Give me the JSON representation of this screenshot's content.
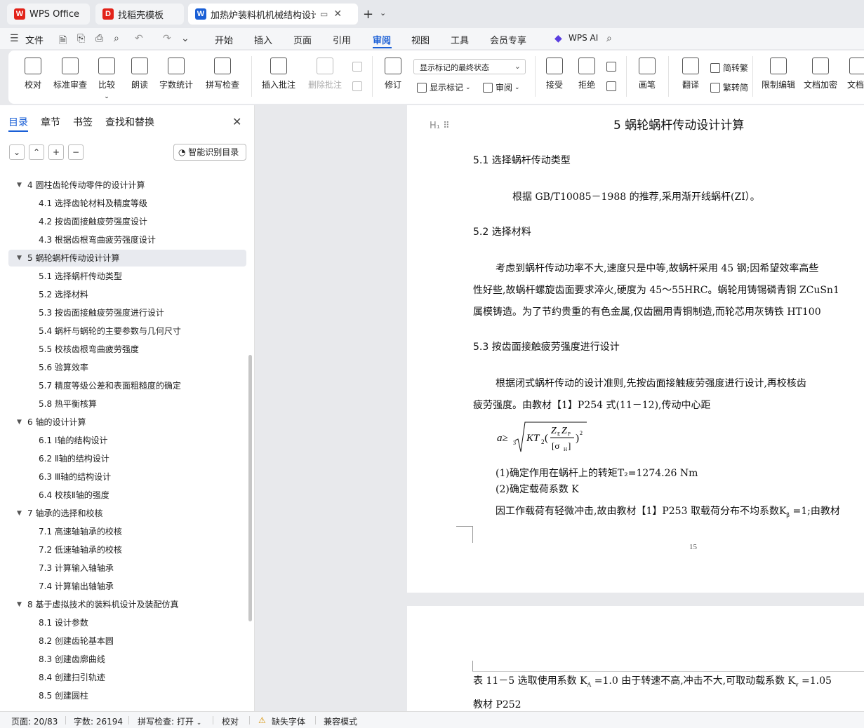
{
  "tabs": [
    {
      "label": "WPS Office",
      "logo": "W",
      "logo_color": "#e2231a"
    },
    {
      "label": "找稻壳模板",
      "logo": "D",
      "logo_color": "#e2231a"
    },
    {
      "label": "加热炉装料机机械结构设计 说",
      "logo": "W",
      "logo_color": "#1a5fd6"
    }
  ],
  "menu": {
    "file": "文件",
    "items": [
      "开始",
      "插入",
      "页面",
      "引用",
      "审阅",
      "视图",
      "工具",
      "会员专享"
    ],
    "active": "审阅",
    "wps_ai": "WPS AI"
  },
  "ribbon": {
    "proofread": "校对",
    "standard_review": "标准审查",
    "compare": "比较",
    "read_aloud": "朗读",
    "word_count": "字数统计",
    "spell_check": "拼写检查",
    "insert_comment": "插入批注",
    "delete_comment": "删除批注",
    "revise": "修订",
    "markup_state": "显示标记的最终状态",
    "show_markup": "显示标记",
    "review": "审阅",
    "accept": "接受",
    "reject": "拒绝",
    "pen": "画笔",
    "translate": "翻译",
    "to_traditional": "简转繁",
    "to_simplified": "繁转简",
    "restrict_edit": "限制编辑",
    "doc_encrypt": "文档加密",
    "doc_more": "文档"
  },
  "nav": {
    "tabs": [
      "目录",
      "章节",
      "书签",
      "查找和替换"
    ],
    "active_tab": "目录",
    "smart_toc": "智能识别目录",
    "items": [
      {
        "level": 1,
        "text": "4   圆柱齿轮传动零件的设计计算"
      },
      {
        "level": 2,
        "text": "4.1  选择齿轮材料及精度等级"
      },
      {
        "level": 2,
        "text": "4.2 按齿面接触疲劳强度设计"
      },
      {
        "level": 2,
        "text": "4.3  根据齿根弯曲疲劳强度设计"
      },
      {
        "level": 1,
        "text": "5   蜗轮蜗杆传动设计计算",
        "selected": true
      },
      {
        "level": 2,
        "text": "5.1  选择蜗杆传动类型"
      },
      {
        "level": 2,
        "text": "5.2  选择材料"
      },
      {
        "level": 2,
        "text": "5.3  按齿面接触疲劳强度进行设计"
      },
      {
        "level": 2,
        "text": "5.4  蜗杆与蜗轮的主要参数与几何尺寸"
      },
      {
        "level": 2,
        "text": "5.5  校核齿根弯曲疲劳强度"
      },
      {
        "level": 2,
        "text": "5.6  验算效率"
      },
      {
        "level": 2,
        "text": "5.7  精度等级公差和表面粗糙度的确定"
      },
      {
        "level": 2,
        "text": "5.8  热平衡核算"
      },
      {
        "level": 1,
        "text": "6   轴的设计计算"
      },
      {
        "level": 2,
        "text": "6.1  Ⅰ轴的结构设计"
      },
      {
        "level": 2,
        "text": "6.2  Ⅱ轴的结构设计"
      },
      {
        "level": 2,
        "text": "6.3  Ⅲ轴的结构设计"
      },
      {
        "level": 2,
        "text": "6.4  校核Ⅱ轴的强度"
      },
      {
        "level": 1,
        "text": "7   轴承的选择和校核"
      },
      {
        "level": 2,
        "text": "7.1  高速轴轴承的校核"
      },
      {
        "level": 2,
        "text": "7.2  低速轴轴承的校核"
      },
      {
        "level": 2,
        "text": "7.3  计算输入轴轴承"
      },
      {
        "level": 2,
        "text": "7.4  计算输出轴轴承"
      },
      {
        "level": 1,
        "text": "8   基于虚拟技术的装料机设计及装配仿真"
      },
      {
        "level": 2,
        "text": "8.1 设计参数"
      },
      {
        "level": 2,
        "text": "8.2 创建齿轮基本圆"
      },
      {
        "level": 2,
        "text": "8.3 创建齿廓曲线"
      },
      {
        "level": 2,
        "text": "8.4 创建扫引轨迹"
      },
      {
        "level": 2,
        "text": "8.5 创建圆柱"
      }
    ]
  },
  "doc": {
    "chapter_title": "5   蜗轮蜗杆传动设计计算",
    "s51": "5.1  选择蜗杆传动类型",
    "p51": "根据 GB/T10085－1988 的推荐,采用渐开线蜗杆(ZI）。",
    "s52": "5.2  选择材料",
    "p52_1": "考虑到蜗杆传动功率不大,速度只是中等,故蜗杆采用 45 钢;因希望效率高些",
    "p52_2": "性好些,故蜗杆螺旋齿面要求淬火,硬度为 45～55HRC。蜗轮用铸锡磷青铜 ZCuSn1",
    "p52_3": "属模铸造。为了节约贵重的有色金属,仅齿圈用青铜制造,而轮芯用灰铸铁 HT100",
    "s53": "5.3  按齿面接触疲劳强度进行设计",
    "p53_1": "根据闭式蜗杆传动的设计准则,先按齿面接触疲劳强度进行设计,再校核齿",
    "p53_2": "疲劳强度。由教材【1】P254 式(11－12),传动中心距",
    "step1": "(1)确定作用在蜗杆上的转矩T₂=1274.26 Nm",
    "step2": "(2)确定载荷系数 K",
    "p_load": "因工作载荷有轻微冲击,故由教材【1】P253 取载荷分布不均系数K",
    "p_load_tail": "=1;由教材",
    "page_number": "15",
    "p2_1": "表 11－5 选取使用系数 K",
    "p2_1b": "=1.0 由于转速不高,冲击不大,可取动载系数 K",
    "p2_1c": "=1.05",
    "p2_2": "教材 P252"
  },
  "status": {
    "page": "页面: 20/83",
    "words": "字数: 26194",
    "spell": "拼写检查: 打开",
    "proof": "校对",
    "missing_font": "缺失字体",
    "compat": "兼容模式"
  }
}
